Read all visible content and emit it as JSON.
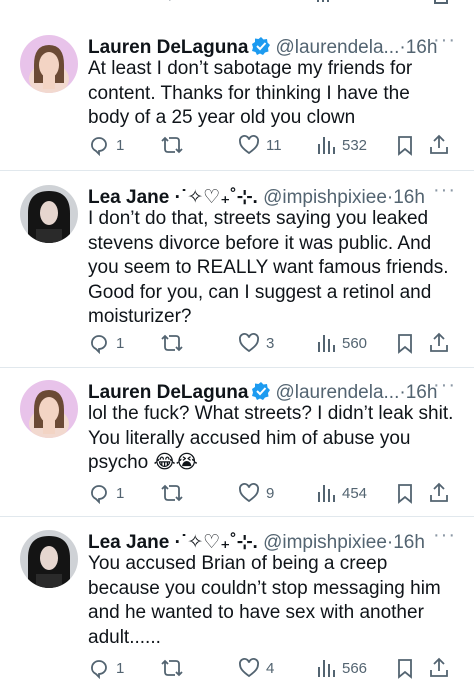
{
  "tweets": [
    {
      "author": "Lauren DeLaguna",
      "handle": "@laurendela...",
      "time": "16h",
      "text": "At least I don’t sabotage my friends for content. Thanks for thinking I have the body of a 25 year old you clown",
      "replies": "1",
      "likes": "11",
      "views": "532"
    },
    {
      "author": "Lea Jane ·˙✧♡₊˚⊹.",
      "handle": "@impishpixiee",
      "time": "16h",
      "text": "I don’t do that, streets saying you leaked stevens divorce before it was public. And you seem to REALLY want famous friends. Good for you, can I suggest a retinol and moisturizer?",
      "replies": "1",
      "likes": "3",
      "views": "560"
    },
    {
      "author": "Lauren DeLaguna",
      "handle": "@laurendela...",
      "time": "16h",
      "text": "lol the fuck? What streets? I didn’t leak shit. You literally accused him of abuse you psycho 😂😭",
      "replies": "1",
      "likes": "9",
      "views": "454"
    },
    {
      "author": "Lea Jane ·˙✧♡₊˚⊹.",
      "handle": "@impishpixiee",
      "time": "16h",
      "text": "You accused Brian of being a creep because you couldn’t stop messaging him and he wanted to have sex with another adult......",
      "replies": "1",
      "likes": "4",
      "views": "566"
    }
  ],
  "ui": {
    "separator": "·",
    "more": "···",
    "accent": "#1d9bf0",
    "icons": [
      "reply-icon",
      "retweet-icon",
      "like-icon",
      "views-icon",
      "bookmark-icon",
      "share-icon",
      "verified-badge-icon",
      "more-icon"
    ]
  }
}
